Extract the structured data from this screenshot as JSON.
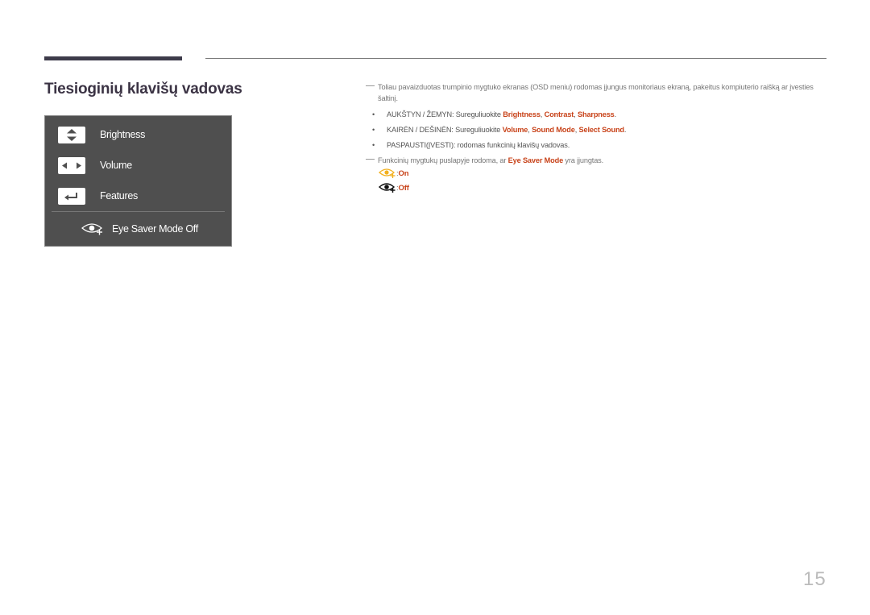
{
  "page": {
    "title": "Tiesioginių klavišų vadovas",
    "page_number": "15"
  },
  "osd_menu": {
    "items": [
      {
        "key_icon": "up-down-arrows-icon",
        "label": "Brightness"
      },
      {
        "key_icon": "left-right-arrows-icon",
        "label": "Volume"
      },
      {
        "key_icon": "enter-icon",
        "label": "Features"
      }
    ],
    "eye_saver": {
      "icon": "eye-saver-icon",
      "label": "Eye Saver Mode Off"
    }
  },
  "content": {
    "note1": "Toliau pavaizduotas trumpinio mygtuko ekranas (OSD meniu) rodomas įjungus monitoriaus ekraną, pakeitus kompiuterio raišką ar įvesties šaltinį.",
    "bullets": [
      {
        "prefix": "AUKŠTYN / ŽEMYN: Sureguliuokite ",
        "items": [
          "Brightness",
          "Contrast",
          "Sharpness"
        ],
        "suffix": "."
      },
      {
        "prefix": "KAIRĖN / DEŠINĖN: Sureguliuokite ",
        "items": [
          "Volume",
          "Sound Mode",
          "Select Sound"
        ],
        "suffix": "."
      },
      {
        "text": "PASPAUSTI(ĮVESTI): rodomas funkcinių klavišų vadovas."
      }
    ],
    "note2_prefix": "Funkcinių mygtukų puslapyje rodoma, ar ",
    "note2_highlight": "Eye Saver Mode",
    "note2_suffix": " yra įjungtas.",
    "legend": [
      {
        "icon": "eye-saver-on-icon",
        "separator": ": ",
        "label": "On",
        "color": "#f2b01e"
      },
      {
        "icon": "eye-saver-off-icon",
        "separator": ": ",
        "label": "Off",
        "color": "#111111"
      }
    ]
  },
  "colors": {
    "highlight": "#c8431a",
    "osd_background": "#4f4f4f",
    "title": "#3b3344"
  }
}
